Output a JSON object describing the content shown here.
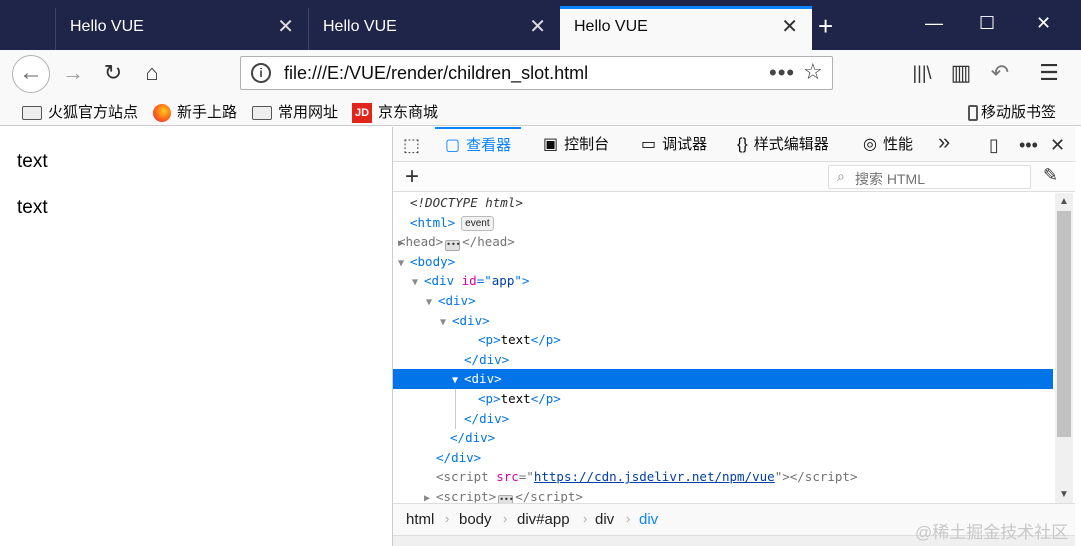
{
  "tabs": [
    {
      "title": "Hello VUE",
      "close": "✕",
      "active": false
    },
    {
      "title": "Hello VUE",
      "close": "✕",
      "active": false
    },
    {
      "title": "Hello VUE",
      "close": "✕",
      "active": true
    }
  ],
  "window_controls": {
    "new_tab": "+",
    "minimize": "—",
    "maximize": "☐",
    "close": "✕"
  },
  "nav": {
    "back": "←",
    "forward": "→",
    "reload": "↻",
    "home": "⌂",
    "url": "file:///E:/VUE/render/children_slot.html",
    "page_actions": "•••",
    "bookmark": "☆",
    "library": "|||\\",
    "sidebar": "▥",
    "undo": "↶",
    "menu": "☰"
  },
  "bookmarks": {
    "items": [
      "火狐官方站点",
      "新手上路",
      "常用网址",
      "京东商城"
    ],
    "jd_logo": "JD",
    "mobile": "移动版书签"
  },
  "page": {
    "lines": [
      "text",
      "text"
    ]
  },
  "devtools": {
    "tabs": [
      {
        "icon": "▢",
        "label": "查看器"
      },
      {
        "icon": "▣",
        "label": "控制台"
      },
      {
        "icon": "▭",
        "label": "调试器"
      },
      {
        "icon": "{}",
        "label": "样式编辑器"
      },
      {
        "icon": "◎",
        "label": "性能"
      }
    ],
    "overflow": "»",
    "search_placeholder": "搜索 HTML",
    "tree": {
      "doctype": "<!DOCTYPE html>",
      "event_badge": "event",
      "attr_id": "id",
      "attr_id_value": "app",
      "attr_src": "src",
      "script_url": "https://cdn.jsdelivr.net/npm/vue",
      "text_node": "text"
    },
    "breadcrumbs": [
      "html",
      "body",
      "div#app",
      "div",
      "div"
    ]
  },
  "watermark": "@稀土掘金技术社区"
}
